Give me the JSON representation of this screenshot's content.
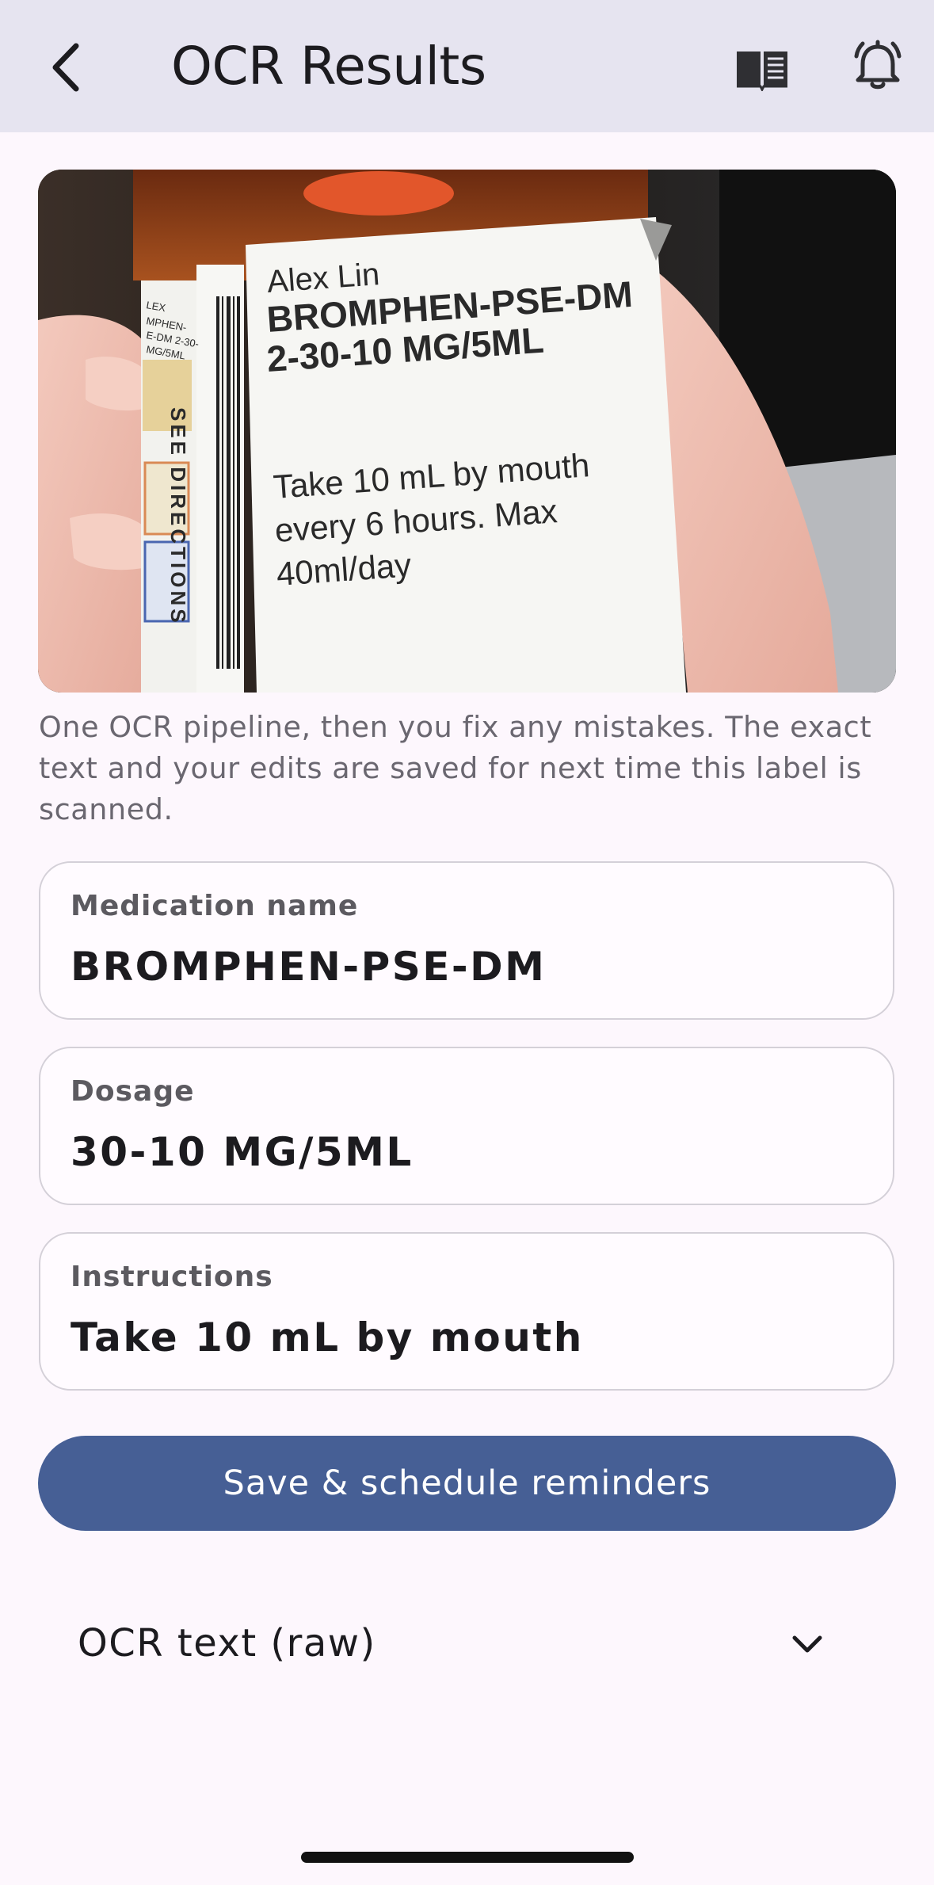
{
  "app_bar": {
    "title": "OCR Results",
    "back_icon": "chevron-left-icon",
    "actions": [
      "book-icon",
      "bell-icon"
    ],
    "background": "#e6e4f0"
  },
  "photo": {
    "label_lines": {
      "name": "Alex Lin",
      "drug": "BROMPHEN-PSE-DM",
      "strength": "2-30-10 MG/5ML",
      "directions": [
        "Take 10 mL by mouth",
        "every 6 hours. Max",
        "40ml/day"
      ],
      "side_text": "SEE DIRECTIONS",
      "side_small": [
        "LEX",
        "MPHEN-",
        "E-DM 2-30-",
        "MG/5ML"
      ]
    }
  },
  "hint": "One OCR pipeline, then you fix any mistakes. The exact text and your edits are saved for next time this label is scanned.",
  "fields": {
    "medication": {
      "label": "Medication name",
      "value": "BROMPHEN-PSE-DM"
    },
    "dosage": {
      "label": "Dosage",
      "value": "30-10 MG/5ML"
    },
    "instructions": {
      "label": "Instructions",
      "value": "Take 10 mL by mouth"
    }
  },
  "save_button": {
    "label": "Save & schedule reminders",
    "color": "#465f95"
  },
  "ocr_raw": {
    "label": "OCR text (raw)",
    "icon": "chevron-down-icon"
  }
}
